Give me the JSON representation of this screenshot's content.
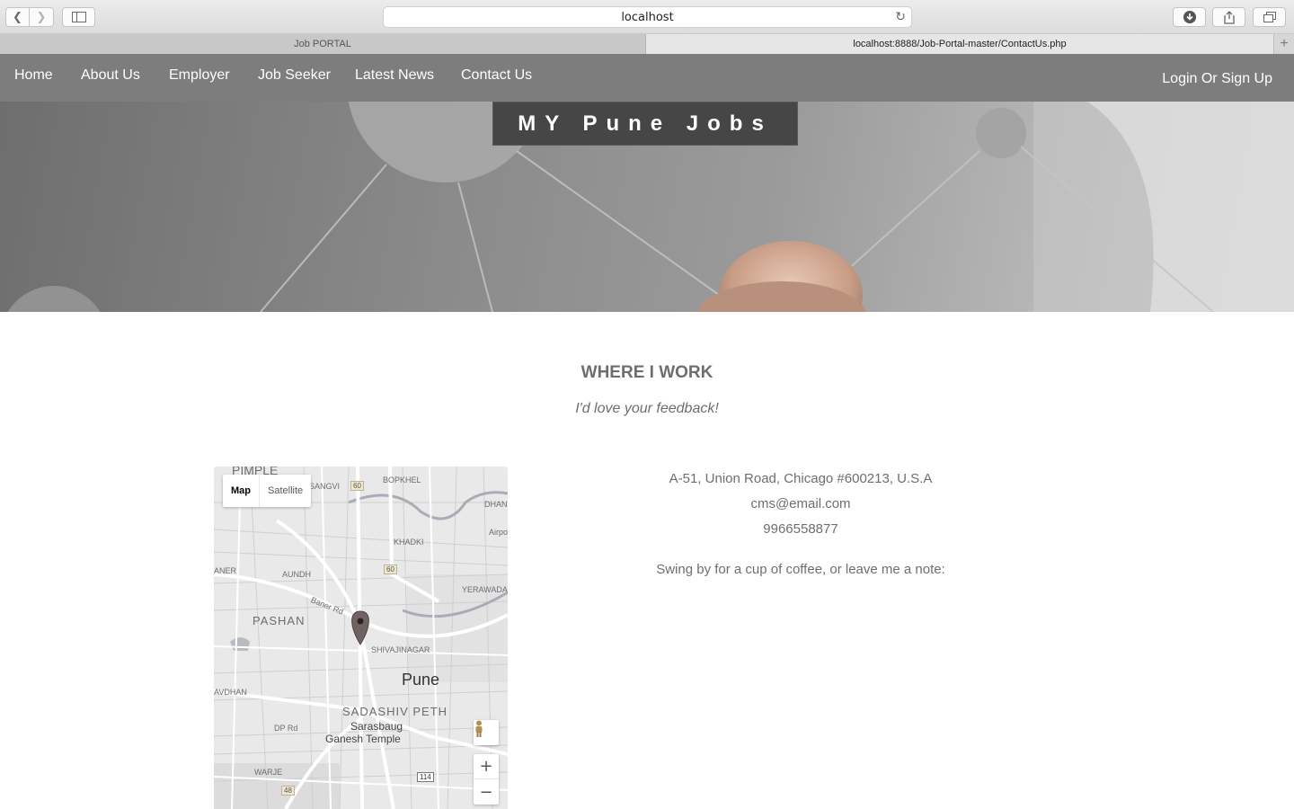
{
  "browser": {
    "address": "localhost",
    "tabs": [
      {
        "label": "Job PORTAL",
        "active": false
      },
      {
        "label": "localhost:8888/Job-Portal-master/ContactUs.php",
        "active": true
      }
    ],
    "new_tab": "+"
  },
  "nav": {
    "items": [
      "Home",
      "About Us",
      "Employer",
      "Job Seeker",
      "Latest News",
      "Contact Us"
    ],
    "login": "Login Or Sign Up"
  },
  "hero": {
    "brand": "MY Pune Jobs"
  },
  "section": {
    "title": "WHERE I WORK",
    "subtitle": "I'd love your feedback!"
  },
  "map": {
    "type_map": "Map",
    "type_satellite": "Satellite",
    "labels": {
      "pimple": "PIMPLE",
      "sangvi": "SANGVI",
      "bopkhel": "BOPKHEL",
      "dhan": "DHAN",
      "khadki": "KHADKI",
      "airpo": "Airpo",
      "aner": "ANER",
      "aundh": "AUNDH",
      "yerawada": "YERAWADA",
      "baner_rd": "Baner Rd",
      "pashan": "PASHAN",
      "shivajinagar": "SHIVAJINAGAR",
      "pune": "Pune",
      "avdhan": "AVDHAN",
      "sadashiv_peth": "SADASHIV PETH",
      "sarasbaug": "Sarasbaug",
      "ganesh_temple": "Ganesh Temple",
      "dp_rd": "DP Rd",
      "warje": "WARJE",
      "hw60a": "60",
      "hw60b": "60",
      "hw48": "48",
      "hw114": "114",
      "zoom_in": "+",
      "zoom_out": "−"
    }
  },
  "contact": {
    "address": "A-51, Union Road, Chicago #600213, U.S.A",
    "email": "cms@email.com",
    "phone": "9966558877",
    "note": "Swing by for a cup of coffee, or leave me a note:"
  }
}
